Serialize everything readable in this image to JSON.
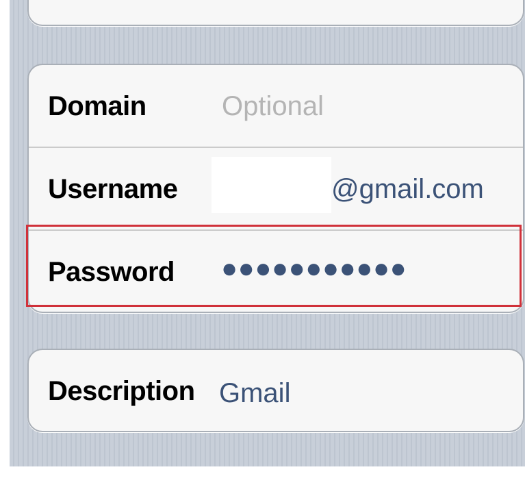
{
  "form": {
    "domain": {
      "label": "Domain",
      "placeholder": "Optional",
      "value": ""
    },
    "username": {
      "label": "Username",
      "value": "",
      "suffix": "@gmail.com"
    },
    "password": {
      "label": "Password",
      "masked_value": "●●●●●●●●●●●"
    },
    "description": {
      "label": "Description",
      "value": "Gmail"
    }
  },
  "highlight": {
    "target": "password-row",
    "color": "#d0313a"
  },
  "colors": {
    "background_stripes": "#c5ccd6",
    "field_value": "#3b5277",
    "placeholder": "#b4b4b4"
  }
}
